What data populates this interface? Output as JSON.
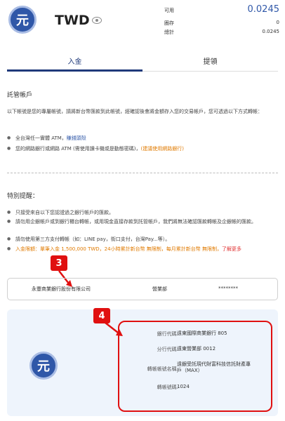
{
  "header": {
    "currency_icon_char": "元",
    "currency": "TWD",
    "available_label": "可用",
    "available_value": "0.0245",
    "frozen_label": "圈存",
    "frozen_value": "0",
    "total_label": "總計",
    "total_value": "0.0245"
  },
  "tabs": {
    "deposit": "入金",
    "withdraw": "提領"
  },
  "escrow": {
    "title": "託管帳戶",
    "desc": "以下帳號是您的專屬帳號，請將新台幣匯款到此帳號，經確認後會將金額存入您的交易帳戶，您可透過以下方式轉帳：",
    "bullet1_text": "全台灣任一實體 ATM，",
    "bullet1_link": "賺錢頭殼",
    "bullet2_text": "您的網路銀行或網路 ATM (需使用讀卡機或是動態密碼)，",
    "bullet2_link": "(建議使用網路銀行)"
  },
  "notice": {
    "title": "特別提醒：",
    "items": [
      "只接受來自以下您認證過之銀行帳戶的匯款。",
      "請勿用企銀帳戶或到銀行櫃台轉帳，或用現金直接存款到託管帳戶，我們將無法確認匯款轉帳及企銀帳的匯款。",
      "請勿使用第三方支付轉帳（如：LINE pay，街口支付，台灣Pay...等）。"
    ],
    "limit_text": "入金限額：單筆入金 1,500,000 TWD，24小時累計新台幣 無限制，每月累計新台幣 無限制，",
    "limit_link": "了解更多"
  },
  "badges": {
    "three": "3",
    "four": "4"
  },
  "bank_account": {
    "bank_name": "永豐商業銀行股份有限公司",
    "branch": "營業部",
    "account_masked": "********"
  },
  "details": {
    "rows": [
      {
        "label": "銀行代碼:",
        "value": "遠東國際商業銀行 805"
      },
      {
        "label": "分行代碼:",
        "value": "遠東營業部 0012"
      },
      {
        "label": "轉帳帳號名稱:",
        "value": "遠銀受託現代財富科技信託財產專戶（MAX）"
      },
      {
        "label": "轉帳號碼:",
        "value": "1024"
      }
    ]
  },
  "colors": {
    "brand": "#2f57a8",
    "tab_active": "#1f3a7a",
    "badge": "#e01010",
    "warning": "#e07a00"
  }
}
